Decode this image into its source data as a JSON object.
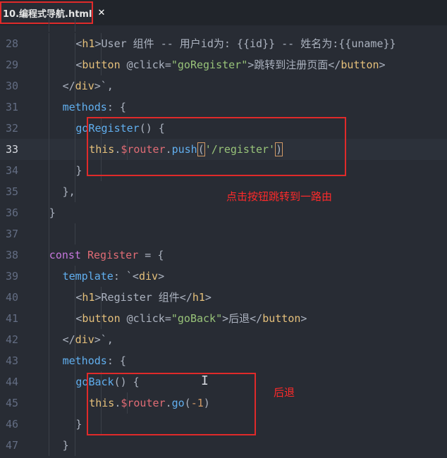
{
  "tab": {
    "title": "10.编程式导航.html",
    "close_glyph": "✕"
  },
  "code_lines": [
    {
      "num": "28",
      "indent": 3,
      "tokens": [
        [
          "pl",
          "<"
        ],
        [
          "tag",
          "h1"
        ],
        [
          "pl",
          ">User 组件 -- 用户id为: {{id}} -- 姓名为:{{uname}}"
        ]
      ]
    },
    {
      "num": "29",
      "indent": 3,
      "tokens": [
        [
          "pl",
          "<"
        ],
        [
          "tag",
          "button"
        ],
        [
          "pl",
          " @click="
        ],
        [
          "str",
          "\"goRegister\""
        ],
        [
          "pl",
          ">跳转到注册页面</"
        ],
        [
          "tag",
          "button"
        ],
        [
          "pl",
          ">"
        ]
      ]
    },
    {
      "num": "30",
      "indent": 2,
      "tokens": [
        [
          "pl",
          "</"
        ],
        [
          "tag",
          "div"
        ],
        [
          "pl",
          ">`,"
        ]
      ]
    },
    {
      "num": "31",
      "indent": 2,
      "tokens": [
        [
          "fn",
          "methods"
        ],
        [
          "pl",
          ": {"
        ]
      ]
    },
    {
      "num": "32",
      "indent": 3,
      "tokens": [
        [
          "fn",
          "goRegister"
        ],
        [
          "pl",
          "() {"
        ]
      ]
    },
    {
      "num": "33",
      "indent": 4,
      "active": true,
      "tokens": [
        [
          "tag",
          "this"
        ],
        [
          "pl",
          "."
        ],
        [
          "var",
          "$router"
        ],
        [
          "pl",
          "."
        ],
        [
          "fn",
          "push"
        ],
        [
          "hl",
          "("
        ],
        [
          "str",
          "'/register'"
        ],
        [
          "hl",
          ")"
        ]
      ]
    },
    {
      "num": "34",
      "indent": 3,
      "tokens": [
        [
          "pl",
          "}"
        ]
      ]
    },
    {
      "num": "35",
      "indent": 2,
      "tokens": [
        [
          "pl",
          "},"
        ]
      ]
    },
    {
      "num": "36",
      "indent": 1,
      "tokens": [
        [
          "pl",
          "}"
        ]
      ]
    },
    {
      "num": "37",
      "indent": 0,
      "tokens": []
    },
    {
      "num": "38",
      "indent": 1,
      "tokens": [
        [
          "kw",
          "const "
        ],
        [
          "var",
          "Register"
        ],
        [
          "pl",
          " = {"
        ]
      ]
    },
    {
      "num": "39",
      "indent": 2,
      "tokens": [
        [
          "fn",
          "template"
        ],
        [
          "pl",
          ": `<"
        ],
        [
          "tag",
          "div"
        ],
        [
          "pl",
          ">"
        ]
      ]
    },
    {
      "num": "40",
      "indent": 3,
      "tokens": [
        [
          "pl",
          "<"
        ],
        [
          "tag",
          "h1"
        ],
        [
          "pl",
          ">Register 组件</"
        ],
        [
          "tag",
          "h1"
        ],
        [
          "pl",
          ">"
        ]
      ]
    },
    {
      "num": "41",
      "indent": 3,
      "tokens": [
        [
          "pl",
          "<"
        ],
        [
          "tag",
          "button"
        ],
        [
          "pl",
          " @click="
        ],
        [
          "str",
          "\"goBack\""
        ],
        [
          "pl",
          ">后退</"
        ],
        [
          "tag",
          "button"
        ],
        [
          "pl",
          ">"
        ]
      ]
    },
    {
      "num": "42",
      "indent": 2,
      "tokens": [
        [
          "pl",
          "</"
        ],
        [
          "tag",
          "div"
        ],
        [
          "pl",
          ">`,"
        ]
      ]
    },
    {
      "num": "43",
      "indent": 2,
      "tokens": [
        [
          "fn",
          "methods"
        ],
        [
          "pl",
          ": {"
        ]
      ]
    },
    {
      "num": "44",
      "indent": 3,
      "tokens": [
        [
          "fn",
          "goBack"
        ],
        [
          "pl",
          "() {"
        ]
      ]
    },
    {
      "num": "45",
      "indent": 4,
      "tokens": [
        [
          "tag",
          "this"
        ],
        [
          "pl",
          "."
        ],
        [
          "var",
          "$router"
        ],
        [
          "pl",
          "."
        ],
        [
          "fn",
          "go"
        ],
        [
          "pl",
          "("
        ],
        [
          "num",
          "-1"
        ],
        [
          "pl",
          ")"
        ]
      ]
    },
    {
      "num": "46",
      "indent": 3,
      "tokens": [
        [
          "pl",
          "}"
        ]
      ]
    },
    {
      "num": "47",
      "indent": 2,
      "tokens": [
        [
          "pl",
          "}"
        ]
      ]
    }
  ],
  "annotations": {
    "push_note": "点击按钮跳转到一路由",
    "back_note": "后退"
  },
  "colors": {
    "annotation_red": "#e02a2a",
    "editor_bg": "#282c34"
  }
}
